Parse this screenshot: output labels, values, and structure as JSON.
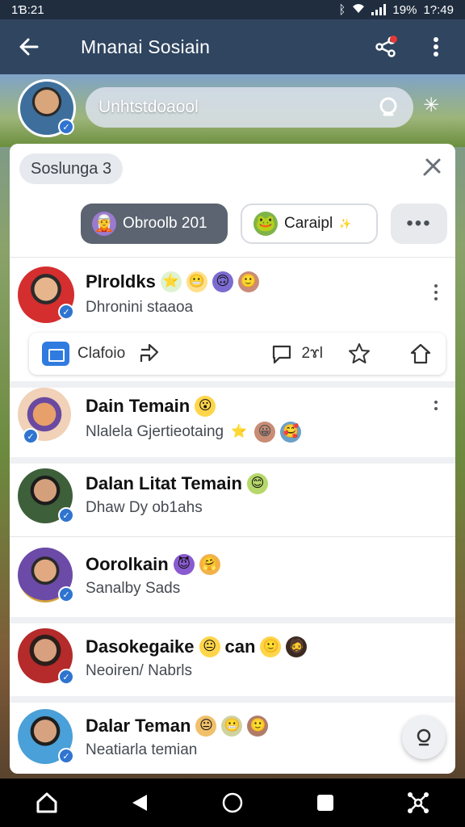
{
  "status_bar": {
    "time": "1Ɓ:21",
    "battery": "19%",
    "clock": "1?:49"
  },
  "app_bar": {
    "title": "Mnanai Sosiain"
  },
  "search": {
    "text": "Unhtstdoaool"
  },
  "filter_chip": {
    "label": "Soslunga 3"
  },
  "filters": [
    {
      "label": "Obroolb 201"
    },
    {
      "label": "Caraipl"
    },
    {
      "label": "•••"
    }
  ],
  "posts": [
    {
      "name": "Plroldks",
      "subtitle": "Dhronini staaoa",
      "emojis": [
        "⭐",
        "😬",
        "🙃",
        "🙂"
      ]
    },
    {
      "name": "Dain Temain",
      "subtitle": "Nlalela Gjertieotaing",
      "name_emojis": [
        "😮"
      ],
      "sub_emojis": [
        "⭐",
        "😀",
        "🥰"
      ]
    },
    {
      "name": "Dalan Litat Temain",
      "subtitle": "Dhaw Dy ob1ahs",
      "name_emojis": [
        "😊"
      ],
      "sub_emojis": []
    },
    {
      "name": "Oorolkain",
      "subtitle": "Sanalby Sads",
      "name_emojis": [
        "😈",
        "🤗"
      ],
      "sub_emojis": []
    },
    {
      "name": "Dasokegaike",
      "name_suffix": "can",
      "subtitle": "Neoiren/ Nabrls",
      "name_emojis": [
        "😐"
      ],
      "suffix_emojis": [
        "🙂",
        "🧔"
      ],
      "sub_emojis": []
    },
    {
      "name": "Dalar Teman",
      "subtitle": "Neatiarla temian",
      "name_emojis": [
        "😐",
        "😬",
        "🙂"
      ],
      "sub_emojis": []
    }
  ],
  "post_actions": {
    "share_label": "Clafoio",
    "comment_count": "2ɤl"
  },
  "colors": {
    "app_bar": "#2f4560",
    "status_bar": "#1f2d3f",
    "accent": "#2f74d0",
    "card": "#ffffff"
  },
  "icons": {
    "back": "arrow-left-icon",
    "share": "share-icon",
    "more": "kebab-icon",
    "search": "search-icon",
    "close": "close-icon",
    "folder": "folder-icon",
    "comment": "comment-icon",
    "star": "star-icon",
    "pin": "home-outline-icon"
  }
}
